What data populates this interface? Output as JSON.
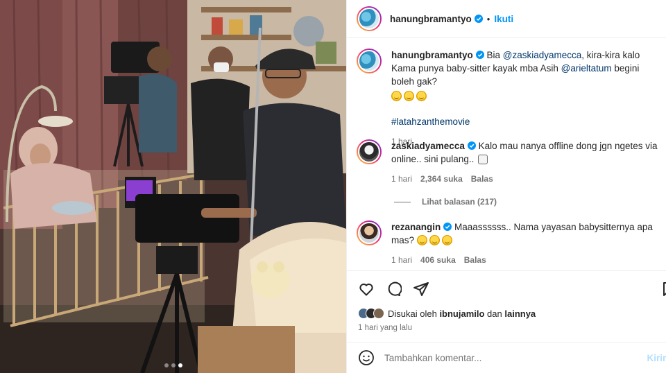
{
  "post": {
    "author": "hanungbramantyo",
    "separator": "•",
    "follow_label": "Ikuti",
    "carousel": {
      "count": 3,
      "active_index": 2
    }
  },
  "caption": {
    "username": "hanungbramantyo",
    "text_1": "Bia ",
    "mention_1": "@zaskiadyamecca",
    "text_2": ", kira-kira kalo Kama punya baby-sitter kayak mba Asih ",
    "mention_2": "@arieltatum",
    "text_3": " begini boleh gak?",
    "emojis": [
      "grinning-sweat-emoji",
      "grinning-sweat-emoji",
      "grinning-sweat-emoji"
    ],
    "hashtag": "#latahzanthemovie",
    "time": "1 hari"
  },
  "comments": [
    {
      "username": "zaskiadyamecca",
      "text": "Kalo mau nanya offline dong jgn ngetes via online.. sini pulang..",
      "emoji": "tissue-emoji",
      "time": "1 hari",
      "likes": "2,364 suka",
      "reply_label": "Balas",
      "view_replies": "Lihat balasan (217)"
    },
    {
      "username": "rezanangin",
      "text": "Maaassssss.. Nama yayasan babysitternya apa mas?",
      "emojis": [
        "grinning-sweat-emoji",
        "grinning-sweat-emoji",
        "grinning-sweat-emoji"
      ],
      "time": "1 hari",
      "likes": "406 suka",
      "reply_label": "Balas"
    }
  ],
  "actions": {
    "icons": [
      "heart-icon",
      "comment-icon",
      "share-icon",
      "bookmark-icon"
    ]
  },
  "likes_summary": {
    "prefix": "Disukai oleh ",
    "user": "ibnujamilo",
    "suffix": " dan ",
    "others": "lainnya"
  },
  "date": "1 hari yang lalu",
  "composer": {
    "placeholder": "Tambahkan komentar...",
    "send_label": "Kirim"
  },
  "colors": {
    "link": "#0095f6",
    "mention": "#00376b",
    "muted": "#737373",
    "border": "#efefef"
  }
}
